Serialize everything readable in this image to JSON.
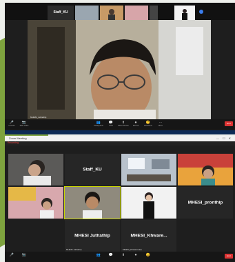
{
  "screen1": {
    "thumbs": [
      {
        "name": "Staff_KU",
        "label": "Staff_KU"
      },
      {
        "label": ""
      },
      {
        "label": ""
      },
      {
        "label": ""
      },
      {
        "label": ""
      }
    ],
    "speaker_label": "MHESI_Juthathip",
    "toolbar": [
      {
        "icon": "🎤",
        "label": "Unmute"
      },
      {
        "icon": "📷",
        "label": "Start Video"
      },
      {
        "icon": "👥",
        "label": "Participants"
      },
      {
        "icon": "💬",
        "label": "Chat"
      },
      {
        "icon": "⬆",
        "label": "Share Screen"
      },
      {
        "icon": "⏺",
        "label": "Record"
      },
      {
        "icon": "😊",
        "label": "Reactions"
      },
      {
        "icon": "⋯",
        "label": "More"
      }
    ],
    "end_label": "End"
  },
  "screen2": {
    "window_title": "Zoom Meeting",
    "zoom_label": "Recording",
    "tiles": [
      {
        "name": "",
        "label": ""
      },
      {
        "name": "Staff_KU",
        "label": ""
      },
      {
        "name": "",
        "label": ""
      },
      {
        "name": "",
        "label": ""
      },
      {
        "name": "",
        "label": ""
      },
      {
        "name": "",
        "label": ""
      },
      {
        "name": "",
        "label": ""
      },
      {
        "name": "MHESI_pronthip",
        "label": ""
      },
      {
        "name": "MHESI Juthathip",
        "label": "MHESI Juthathip"
      },
      {
        "name": "MHESI_Khware...",
        "label": "MHESI_Khwanrudee"
      }
    ],
    "end_label": "End"
  },
  "colors": {
    "accent_green": "#7ea33e",
    "end_red": "#d33333",
    "taskbar": "#0d2a55"
  }
}
